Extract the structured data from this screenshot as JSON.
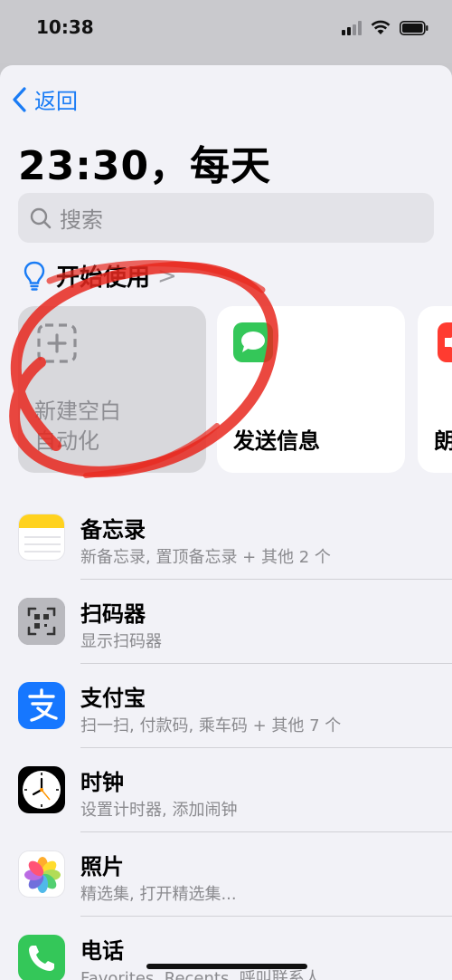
{
  "status_bar": {
    "time": "10:38"
  },
  "nav": {
    "back_label": "返回"
  },
  "page": {
    "title": "23:30，每天"
  },
  "search": {
    "placeholder": "搜索"
  },
  "get_started": {
    "label": "开始使用",
    "chevron": ">"
  },
  "cards": [
    {
      "label_line1": "新建空白",
      "label_line2": "自动化",
      "icon": "add-dashed-square-icon"
    },
    {
      "label_line1": "发送信息",
      "icon": "messages-icon"
    },
    {
      "label_line1": "朗",
      "icon": "speaker-icon"
    }
  ],
  "apps": [
    {
      "title": "备忘录",
      "subtitle": "新备忘录, 置顶备忘录 + 其他 2 个",
      "icon": "notes-icon"
    },
    {
      "title": "扫码器",
      "subtitle": "显示扫码器",
      "icon": "qr-scanner-icon"
    },
    {
      "title": "支付宝",
      "subtitle": "扫一扫, 付款码, 乘车码 + 其他 7 个",
      "icon": "alipay-icon"
    },
    {
      "title": "时钟",
      "subtitle": "设置计时器, 添加闹钟",
      "icon": "clock-icon"
    },
    {
      "title": "照片",
      "subtitle": "精选集, 打开精选集...",
      "icon": "photos-icon"
    },
    {
      "title": "电话",
      "subtitle": "Favorites, Recents, 呼叫联系人",
      "icon": "phone-icon"
    }
  ],
  "colors": {
    "accent": "#1a7cf5",
    "annotation": "#e8281e"
  }
}
